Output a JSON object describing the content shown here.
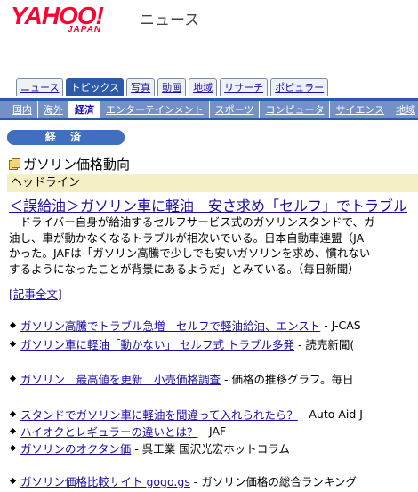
{
  "logo": {
    "text": "YAHOO!",
    "sub": "JAPAN",
    "service": "ニュース"
  },
  "primary_tabs": [
    {
      "label": "ニュース",
      "active": false
    },
    {
      "label": "トピックス",
      "active": true
    },
    {
      "label": "写真",
      "active": false
    },
    {
      "label": "動画",
      "active": false
    },
    {
      "label": "地域",
      "active": false
    },
    {
      "label": "リサーチ",
      "active": false
    },
    {
      "label": "ポピュラー",
      "active": false
    }
  ],
  "secondary_tabs": [
    {
      "label": "国内",
      "active": false
    },
    {
      "label": "海外",
      "active": false
    },
    {
      "label": "経済",
      "active": true
    },
    {
      "label": "エンターテインメント",
      "active": false
    },
    {
      "label": "スポーツ",
      "active": false
    },
    {
      "label": "コンピュータ",
      "active": false
    },
    {
      "label": "サイエンス",
      "active": false
    },
    {
      "label": "地域",
      "active": false
    }
  ],
  "section": {
    "label": "経 済"
  },
  "topic": {
    "title": "ガソリン価格動向"
  },
  "headline_header": "ヘッドライン",
  "main_article": {
    "title": "＜誤給油＞ガソリン車に軽油　安さ求め「セルフ」でトラブル",
    "body_lines": [
      "　ドライバー自身が給油するセルフサービス式のガソリンスタンドで、ガ",
      "油し、車が動かなくなるトラブルが相次いでいる。日本自動車連盟（JA",
      "かった。JAFは「ガソリン高騰で少しでも安いガソリンを求め、慣れない",
      "するようになったことが背景にあるようだ」とみている。（毎日新聞）"
    ],
    "full_link": "[記事全文]"
  },
  "links": [
    {
      "text": "ガソリン高騰でトラブル急増　セルフで軽油給油、エンスト",
      "source": "- J-CAS"
    },
    {
      "text": "ガソリン車に軽油「動かない」 セルフ式 トラブル多発",
      "source": "- 読売新聞("
    },
    {
      "text": "ガソリン　最高値を更新　小売価格調査",
      "source": "- 価格の推移グラフ。毎日"
    },
    {
      "text": "スタンドでガソリン車に軽油を間違って入れられたら？",
      "source": "- Auto Aid J"
    },
    {
      "text": "ハイオクとレギュラーの違いとは？",
      "source": "- JAF"
    },
    {
      "text": "ガソリンのオクタン価",
      "source": "- 呉工業 国沢光宏ホットコラム"
    },
    {
      "text": "ガソリン価格比較サイト gogo.gs",
      "source": "- ガソリン価格の総合ランキング"
    }
  ],
  "colors": {
    "brand_red": "#ff0033",
    "nav_blue": "#2d5aa8",
    "link": "#1a0dab",
    "headline_bg": "#f4efc4"
  }
}
